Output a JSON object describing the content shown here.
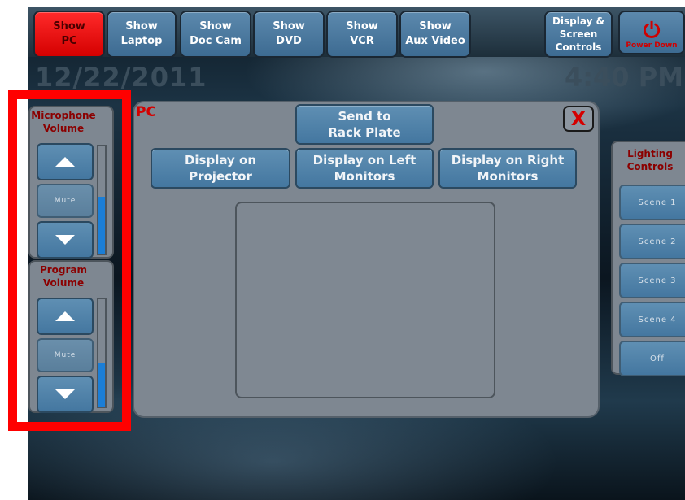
{
  "topbar": {
    "buttons": [
      "Show\nPC",
      "Show\nLaptop",
      "Show\nDoc Cam",
      "Show\nDVD",
      "Show\nVCR",
      "Show\nAux Video",
      "Display &\nScreen\nControls"
    ],
    "power_label": "Power Down"
  },
  "date": "12/22/2011",
  "time": "4:40 PM",
  "panel": {
    "title": "PC",
    "close_label": "X",
    "send_rack": "Send to\nRack Plate",
    "display_projector": "Display on Projector",
    "display_left": "Display on Left\nMonitors",
    "display_right": "Display on Right\nMonitors"
  },
  "microphone": {
    "title": "Microphone\nVolume",
    "mute_label": "Mute",
    "level": 0.53
  },
  "program": {
    "title": "Program\nVolume",
    "mute_label": "Mute",
    "level": 0.41
  },
  "lighting": {
    "title": "Lighting\nControls",
    "scenes": [
      "Scene 1",
      "Scene 2",
      "Scene 3",
      "Scene 4",
      "Off"
    ]
  },
  "colors": {
    "accent_red": "#d40000",
    "button_blue": "#4477a0",
    "highlight": "#ff0000"
  }
}
